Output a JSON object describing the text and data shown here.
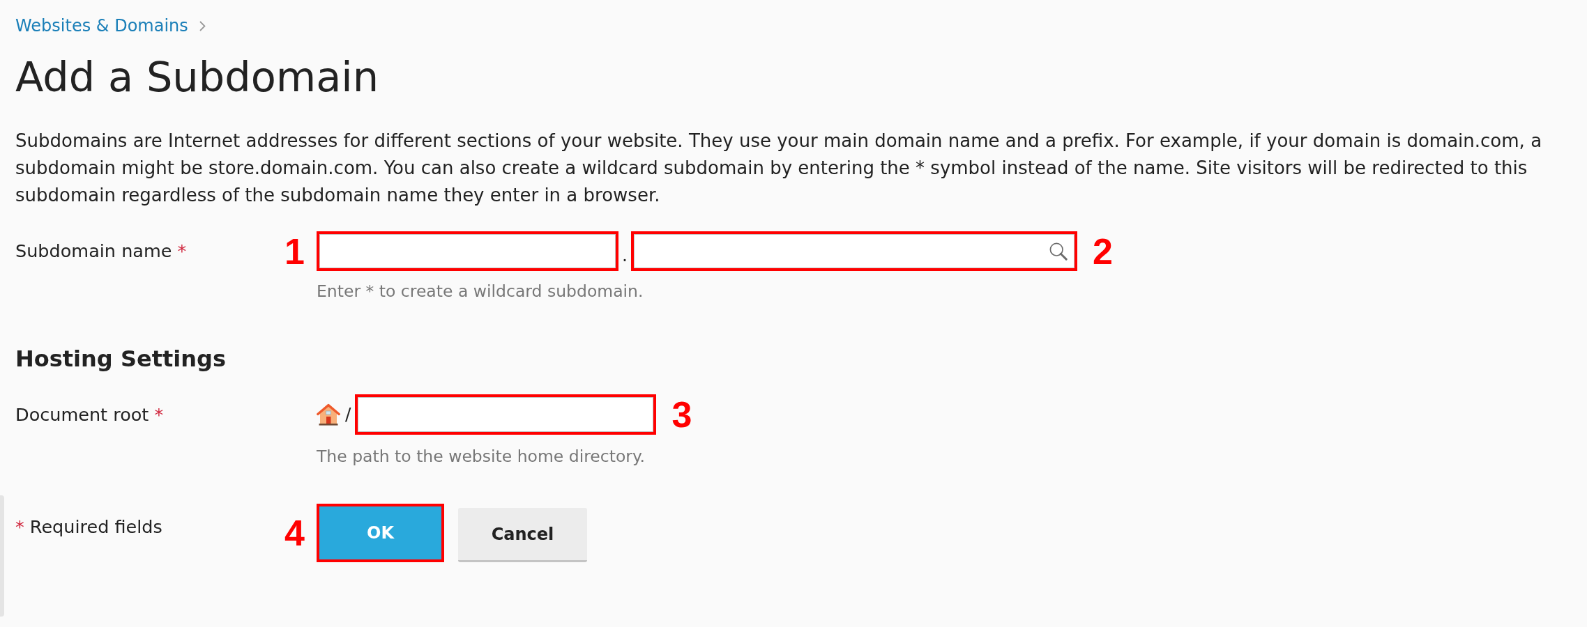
{
  "breadcrumb": [
    {
      "label": "Websites & Domains"
    }
  ],
  "page_title": "Add a Subdomain",
  "description": "Subdomains are Internet addresses for different sections of your website. They use your main domain name and a prefix. For example, if your domain is domain.com, a subdomain might be store.domain.com. You can also create a wildcard subdomain by entering the * symbol instead of the name. Site visitors will be redirected to this subdomain regardless of the subdomain name they enter in a browser.",
  "subdomain_row": {
    "label": "Subdomain name",
    "required_mark": "*",
    "name_field": {
      "marker": "1"
    },
    "separator": ".",
    "domain_field": {
      "marker": "2"
    },
    "hint": "Enter * to create a wildcard subdomain."
  },
  "hosting_settings": {
    "title": "Hosting Settings",
    "document_root": {
      "label": "Document root",
      "required_mark": "*",
      "path_separator": "/",
      "field": {
        "marker": "3"
      },
      "hint": "The path to the website home directory."
    }
  },
  "footer": {
    "required_mark": "*",
    "required_note": "Required fields",
    "buttons": [
      {
        "label": "OK",
        "kind": "primary",
        "marker": "4"
      },
      {
        "label": "Cancel",
        "kind": "secondary"
      }
    ]
  }
}
